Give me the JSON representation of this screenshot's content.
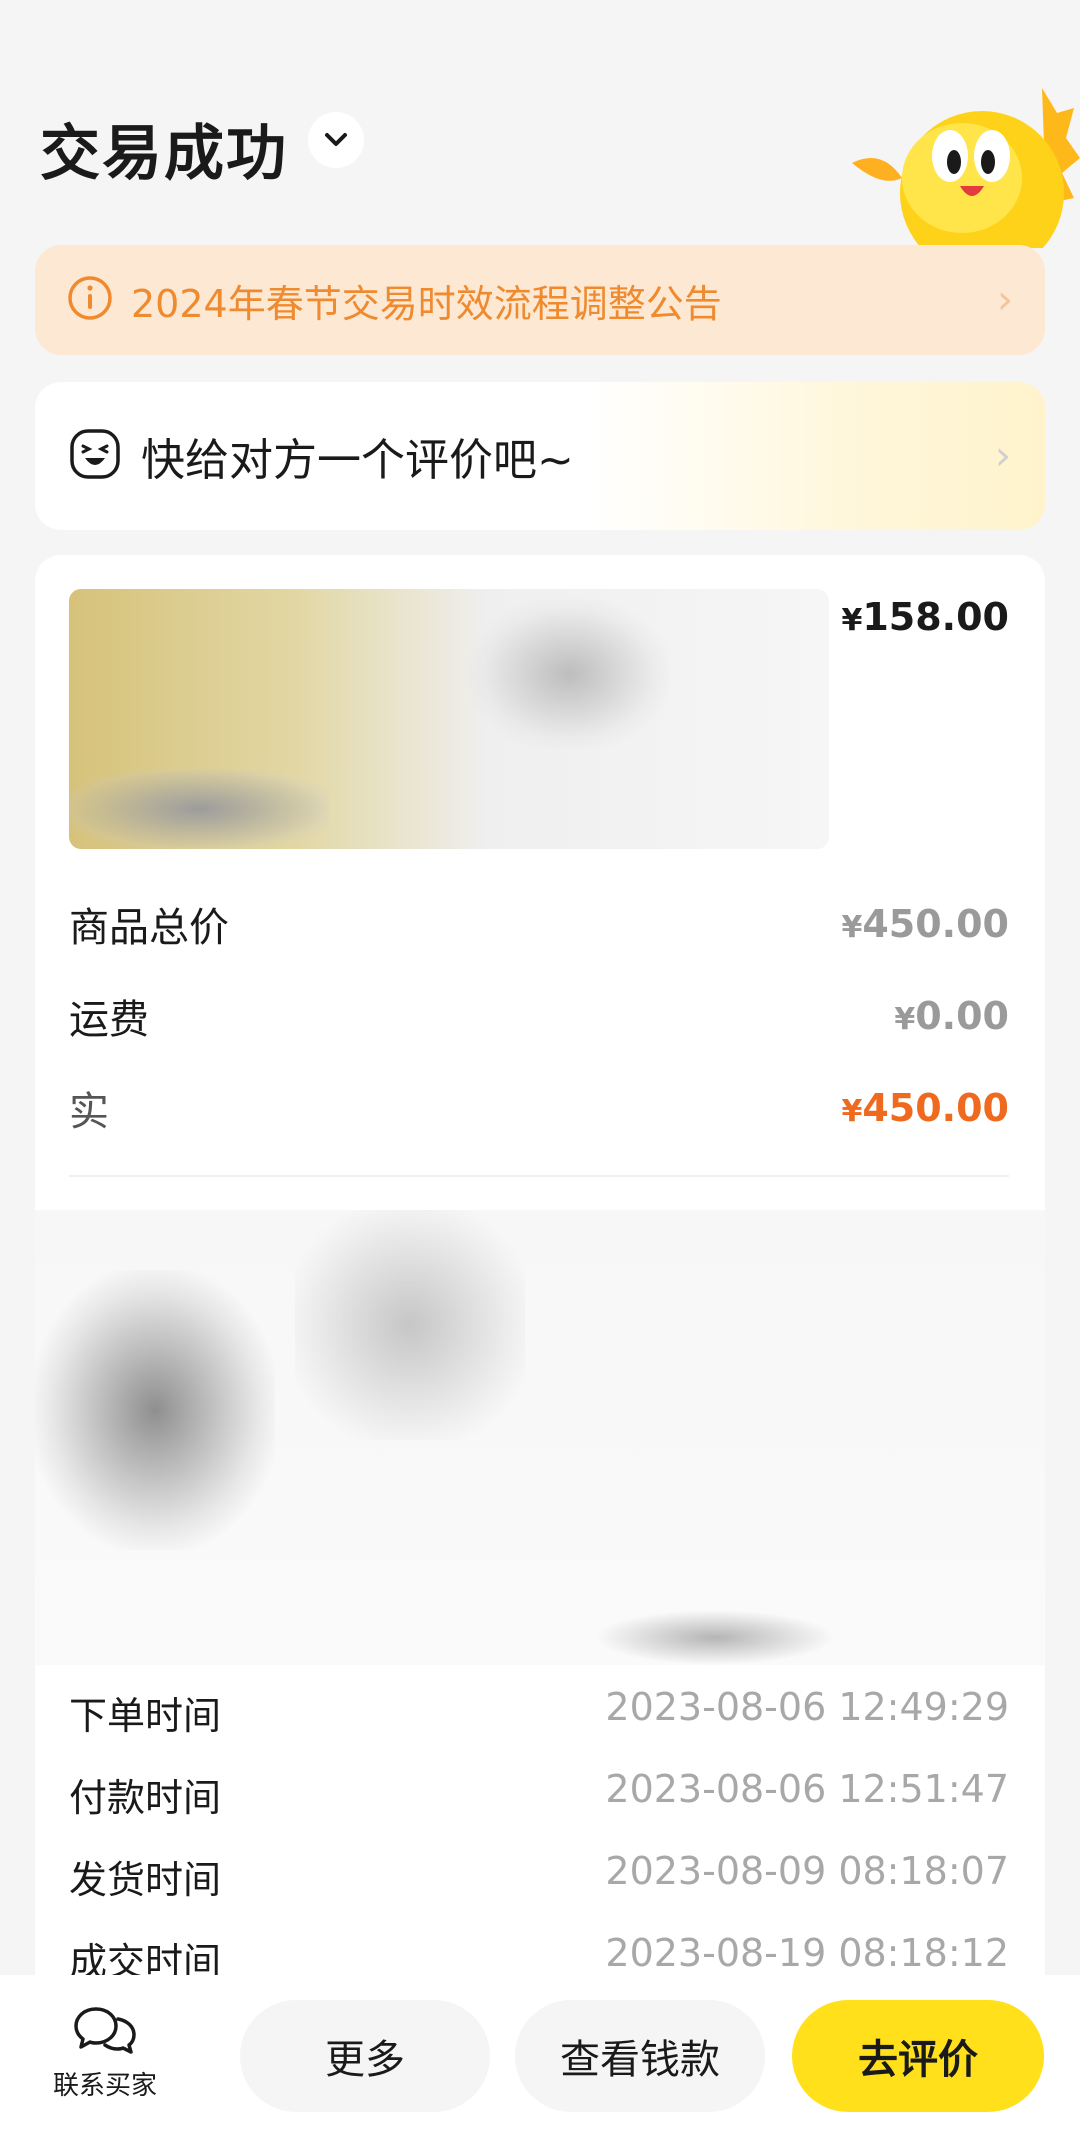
{
  "header": {
    "title": "交易成功"
  },
  "notice": {
    "text": "2024年春节交易时效流程调整公告"
  },
  "review_prompt": {
    "text": "快给对方一个评价吧~"
  },
  "order": {
    "item_price": "158.00",
    "currency": "¥",
    "rows": [
      {
        "label": "商品总价",
        "value": "450.00"
      },
      {
        "label": "运费",
        "value": "0.00"
      },
      {
        "label": "实",
        "value": "450.00"
      }
    ],
    "times": [
      {
        "label": "下单时间",
        "value": "2023-08-06 12:49:29"
      },
      {
        "label": "付款时间",
        "value": "2023-08-06 12:51:47"
      },
      {
        "label": "发货时间",
        "value": "2023-08-09 08:18:07"
      },
      {
        "label": "成交时间",
        "value": "2023-08-19 08:18:12"
      }
    ]
  },
  "bottom_bar": {
    "contact_label": "联系买家",
    "more_label": "更多",
    "funds_label": "查看钱款",
    "review_label": "去评价"
  },
  "colors": {
    "accent_yellow": "#ffe01a",
    "notice_orange": "#ef8a2e",
    "total_orange": "#ef6a1e"
  }
}
